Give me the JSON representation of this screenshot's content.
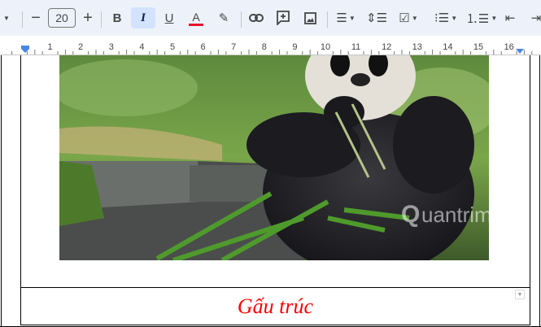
{
  "toolbar": {
    "font_size": "20",
    "minus": "−",
    "plus": "+",
    "bold": "B",
    "italic": "I",
    "underline": "U",
    "text_color": "A",
    "text_color_hex": "#e8112d",
    "active_state": "italic",
    "icons": [
      "caret-down",
      "minus",
      "plus",
      "bold",
      "italic",
      "underline",
      "text-color",
      "highlighter",
      "link",
      "add-comment",
      "insert-image",
      "align-center",
      "line-spacing",
      "checklist",
      "bulleted-list",
      "numbered-list",
      "decrease-indent",
      "increase-indent"
    ]
  },
  "ruler": {
    "ticks": [
      "1",
      "2",
      "3",
      "4",
      "5",
      "6",
      "7",
      "8",
      "9",
      "10",
      "11",
      "12",
      "13",
      "14",
      "15",
      "16"
    ]
  },
  "document": {
    "caption": "Gấu trúc",
    "caption_color": "#ff0000",
    "watermark": "uantrimang"
  }
}
